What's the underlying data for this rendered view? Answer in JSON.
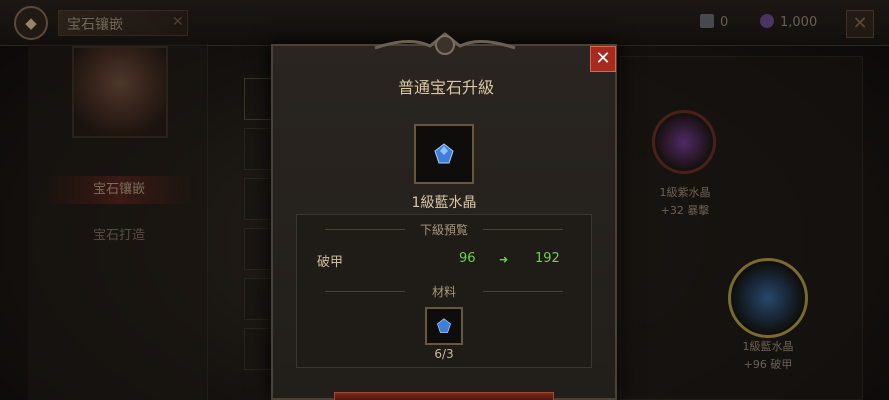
{
  "topbar": {
    "title": "宝石镶嵌",
    "tab_close": "✕",
    "currency1": "0",
    "currency2": "1,000",
    "close": "✕"
  },
  "sidebar": {
    "items": [
      {
        "label": "宝石镶嵌",
        "active": true
      },
      {
        "label": "宝石打造",
        "active": false
      }
    ]
  },
  "right": {
    "gem1_label": "1級紫水晶",
    "gem1_stat": "+32 暴擊",
    "gem2_label": "1級藍水晶",
    "gem2_stat": "+96 破甲"
  },
  "modal": {
    "title": "普通宝石升級",
    "close": "✕",
    "item_name": "1級藍水晶",
    "preview_header": "下級預覧",
    "stat_name": "破甲",
    "stat_current": "96",
    "stat_arrow": "➜",
    "stat_next": "192",
    "material_header": "材料",
    "material_count": "6/3"
  },
  "colors": {
    "accent_red": "#a82a1e",
    "stat_green": "#6fcf54",
    "gem_blue": "#3f7fd8",
    "gem_purple": "#b04fc9"
  }
}
